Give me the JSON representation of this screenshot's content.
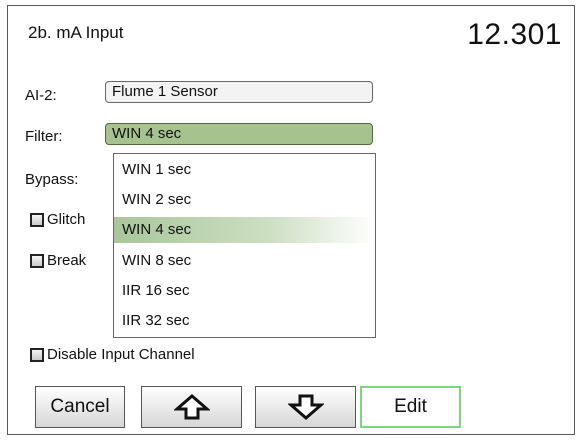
{
  "header": {
    "title": "2b. mA Input",
    "value": "12.301"
  },
  "fields": {
    "ai_label": "AI-2:",
    "ai_value": "Flume 1 Sensor",
    "filter_label": "Filter:",
    "filter_value": "WIN 4 sec",
    "bypass_label": "Bypass:"
  },
  "checkboxes": {
    "glitch": "Glitch",
    "break": "Break",
    "disable": "Disable Input Channel"
  },
  "dropdown": {
    "options": [
      "WIN 1 sec",
      "WIN 2 sec",
      "WIN 4 sec",
      "WIN 8 sec",
      "IIR 16 sec",
      "IIR 32 sec"
    ],
    "selected": "WIN 4 sec"
  },
  "buttons": {
    "cancel": "Cancel",
    "up_icon": "arrow-up-icon",
    "down_icon": "arrow-down-icon",
    "edit": "Edit",
    "edit_border_color": "#7ad87a"
  },
  "colors": {
    "selected_fill": "#a6c38f"
  }
}
